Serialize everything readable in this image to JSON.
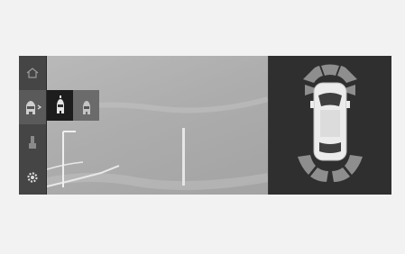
{
  "screen": {
    "colors": {
      "screen_bg": "#3a3a3a",
      "camera_feed": "#adadad",
      "sensor_zone": "#8e8e8e",
      "selected_view": "#1d1d1d"
    }
  },
  "sidebar": {
    "items": [
      {
        "id": "home",
        "icon": "home-icon"
      },
      {
        "id": "camera-view",
        "icon": "car-front-camera-icon",
        "selected": true
      },
      {
        "id": "car-side",
        "icon": "car-side-icon"
      },
      {
        "id": "settings",
        "icon": "gear-icon"
      }
    ]
  },
  "view_popup": {
    "options": [
      {
        "id": "front-view",
        "icon": "car-front-view-icon",
        "active": true
      },
      {
        "id": "top-view",
        "icon": "car-top-view-icon",
        "active": false
      }
    ]
  },
  "topview": {
    "front_sensor_zones": 3,
    "rear_sensor_zones": 4
  }
}
